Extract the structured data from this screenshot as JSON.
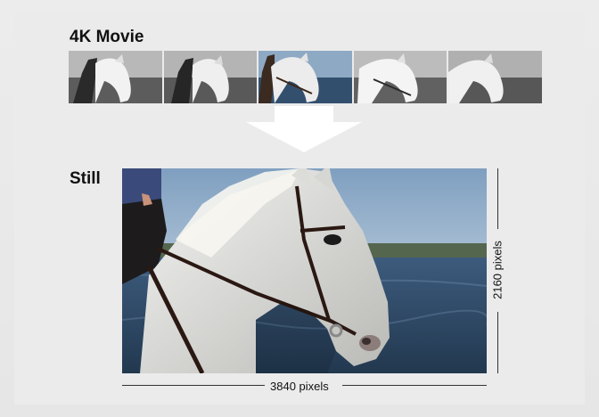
{
  "headings": {
    "movie": "4K Movie",
    "still": "Still"
  },
  "dimensions": {
    "width": "3840 pixels",
    "height": "2160 pixels"
  },
  "filmstrip": {
    "frames": [
      {
        "tone": "grayscale",
        "highlighted": false
      },
      {
        "tone": "grayscale",
        "highlighted": false
      },
      {
        "tone": "color",
        "highlighted": true
      },
      {
        "tone": "grayscale",
        "highlighted": false
      },
      {
        "tone": "grayscale",
        "highlighted": false
      }
    ]
  },
  "icons": {
    "transition": "arrow-down-icon"
  },
  "colors": {
    "background": "#ebebeb",
    "arrow": "#ffffff",
    "sky": "#8aa8c4",
    "sea": "#2f4c6f"
  }
}
